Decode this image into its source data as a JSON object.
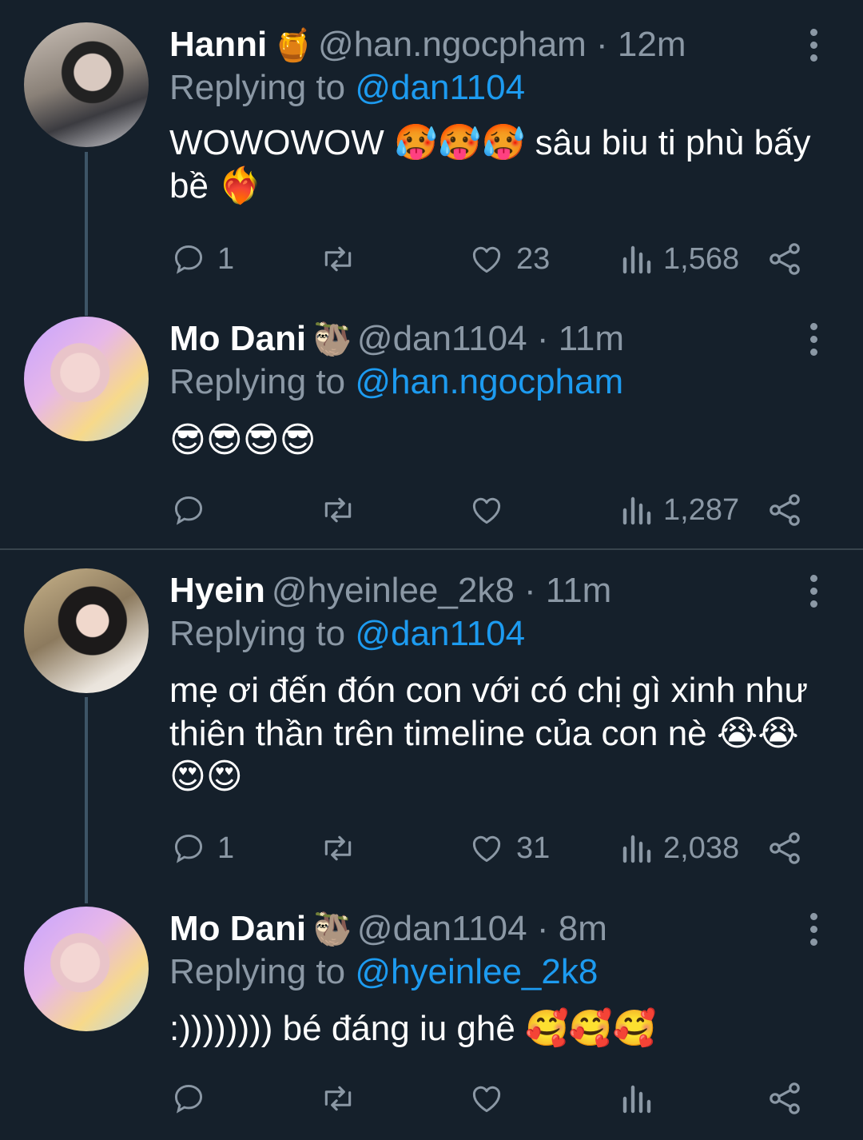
{
  "tweets": [
    {
      "name": "Hanni",
      "badge": "🍯",
      "handle": "@han.ngocpham · 12m",
      "replying_prefix": "Replying to ",
      "replying_to": "@dan1104",
      "text": "WOWOWOW 🥵🥵🥵 sâu biu ti phù bấy bề ❤️‍🔥",
      "replies": "1",
      "retweets": "",
      "likes": "23",
      "views": "1,568"
    },
    {
      "name": "Mo Dani",
      "badge": "🦥",
      "handle": "@dan1104 · 11m",
      "replying_prefix": "Replying to ",
      "replying_to": "@han.ngocpham",
      "text": "😎😎😎😎",
      "replies": "",
      "retweets": "",
      "likes": "",
      "views": "1,287"
    },
    {
      "name": "Hyein",
      "badge": "",
      "handle": "@hyeinlee_2k8 · 11m",
      "replying_prefix": "Replying to ",
      "replying_to": "@dan1104",
      "text": "mẹ ơi đến đón con với có chị gì xinh như thiên thần trên timeline của con nè 😭😭 😍😍",
      "replies": "1",
      "retweets": "",
      "likes": "31",
      "views": "2,038"
    },
    {
      "name": "Mo Dani",
      "badge": "🦥",
      "handle": "@dan1104 · 8m",
      "replying_prefix": "Replying to ",
      "replying_to": "@hyeinlee_2k8",
      "text": ":)))))))) bé đáng iu ghê 🥰🥰🥰",
      "replies": "",
      "retweets": "",
      "likes": "",
      "views": ""
    }
  ],
  "colors": {
    "background": "#15202b",
    "text": "#ffffff",
    "muted": "#8b98a5",
    "accent": "#1d9bf0",
    "divider": "#38444d"
  },
  "icons": [
    "reply-icon",
    "retweet-icon",
    "like-icon",
    "views-icon",
    "share-icon",
    "more-options-icon"
  ]
}
